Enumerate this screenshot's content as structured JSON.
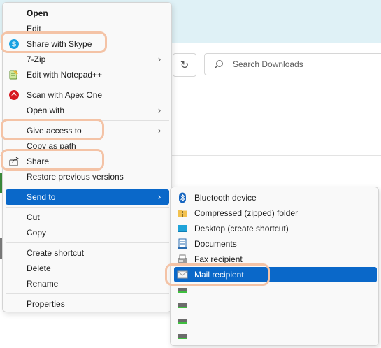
{
  "explorer": {
    "search_placeholder": "Search Downloads"
  },
  "context_menu": {
    "items": [
      {
        "label": "Open"
      },
      {
        "label": "Edit"
      },
      {
        "label": "Share with Skype",
        "icon": "skype-icon"
      },
      {
        "label": "7-Zip"
      },
      {
        "label": "Edit with Notepad++",
        "icon": "notepad-plus-plus-icon"
      },
      {
        "label": "Scan with Apex One",
        "icon": "apex-one-icon"
      },
      {
        "label": "Open with"
      },
      {
        "label": "Give access to"
      },
      {
        "label": "Copy as path"
      },
      {
        "label": "Share",
        "icon": "share-icon"
      },
      {
        "label": "Restore previous versions"
      },
      {
        "label": "Send to"
      },
      {
        "label": "Cut"
      },
      {
        "label": "Copy"
      },
      {
        "label": "Create shortcut"
      },
      {
        "label": "Delete"
      },
      {
        "label": "Rename"
      },
      {
        "label": "Properties"
      }
    ]
  },
  "send_to_menu": {
    "items": [
      {
        "label": "Bluetooth device",
        "icon": "bluetooth-icon"
      },
      {
        "label": "Compressed (zipped) folder",
        "icon": "zip-folder-icon"
      },
      {
        "label": "Desktop (create shortcut)",
        "icon": "desktop-icon"
      },
      {
        "label": "Documents",
        "icon": "documents-icon"
      },
      {
        "label": "Fax recipient",
        "icon": "fax-icon"
      },
      {
        "label": "Mail recipient",
        "icon": "mail-icon"
      },
      {
        "label": "",
        "icon": "drive-icon"
      },
      {
        "label": "",
        "icon": "drive-icon"
      },
      {
        "label": "",
        "icon": "drive-icon"
      },
      {
        "label": "",
        "icon": "drive-icon"
      }
    ]
  },
  "colors": {
    "selection": "#0a68c9",
    "highlight_ring": "#f4c3a6",
    "menu_bg": "#f9f9f9",
    "window_band": "#dff1f6"
  }
}
